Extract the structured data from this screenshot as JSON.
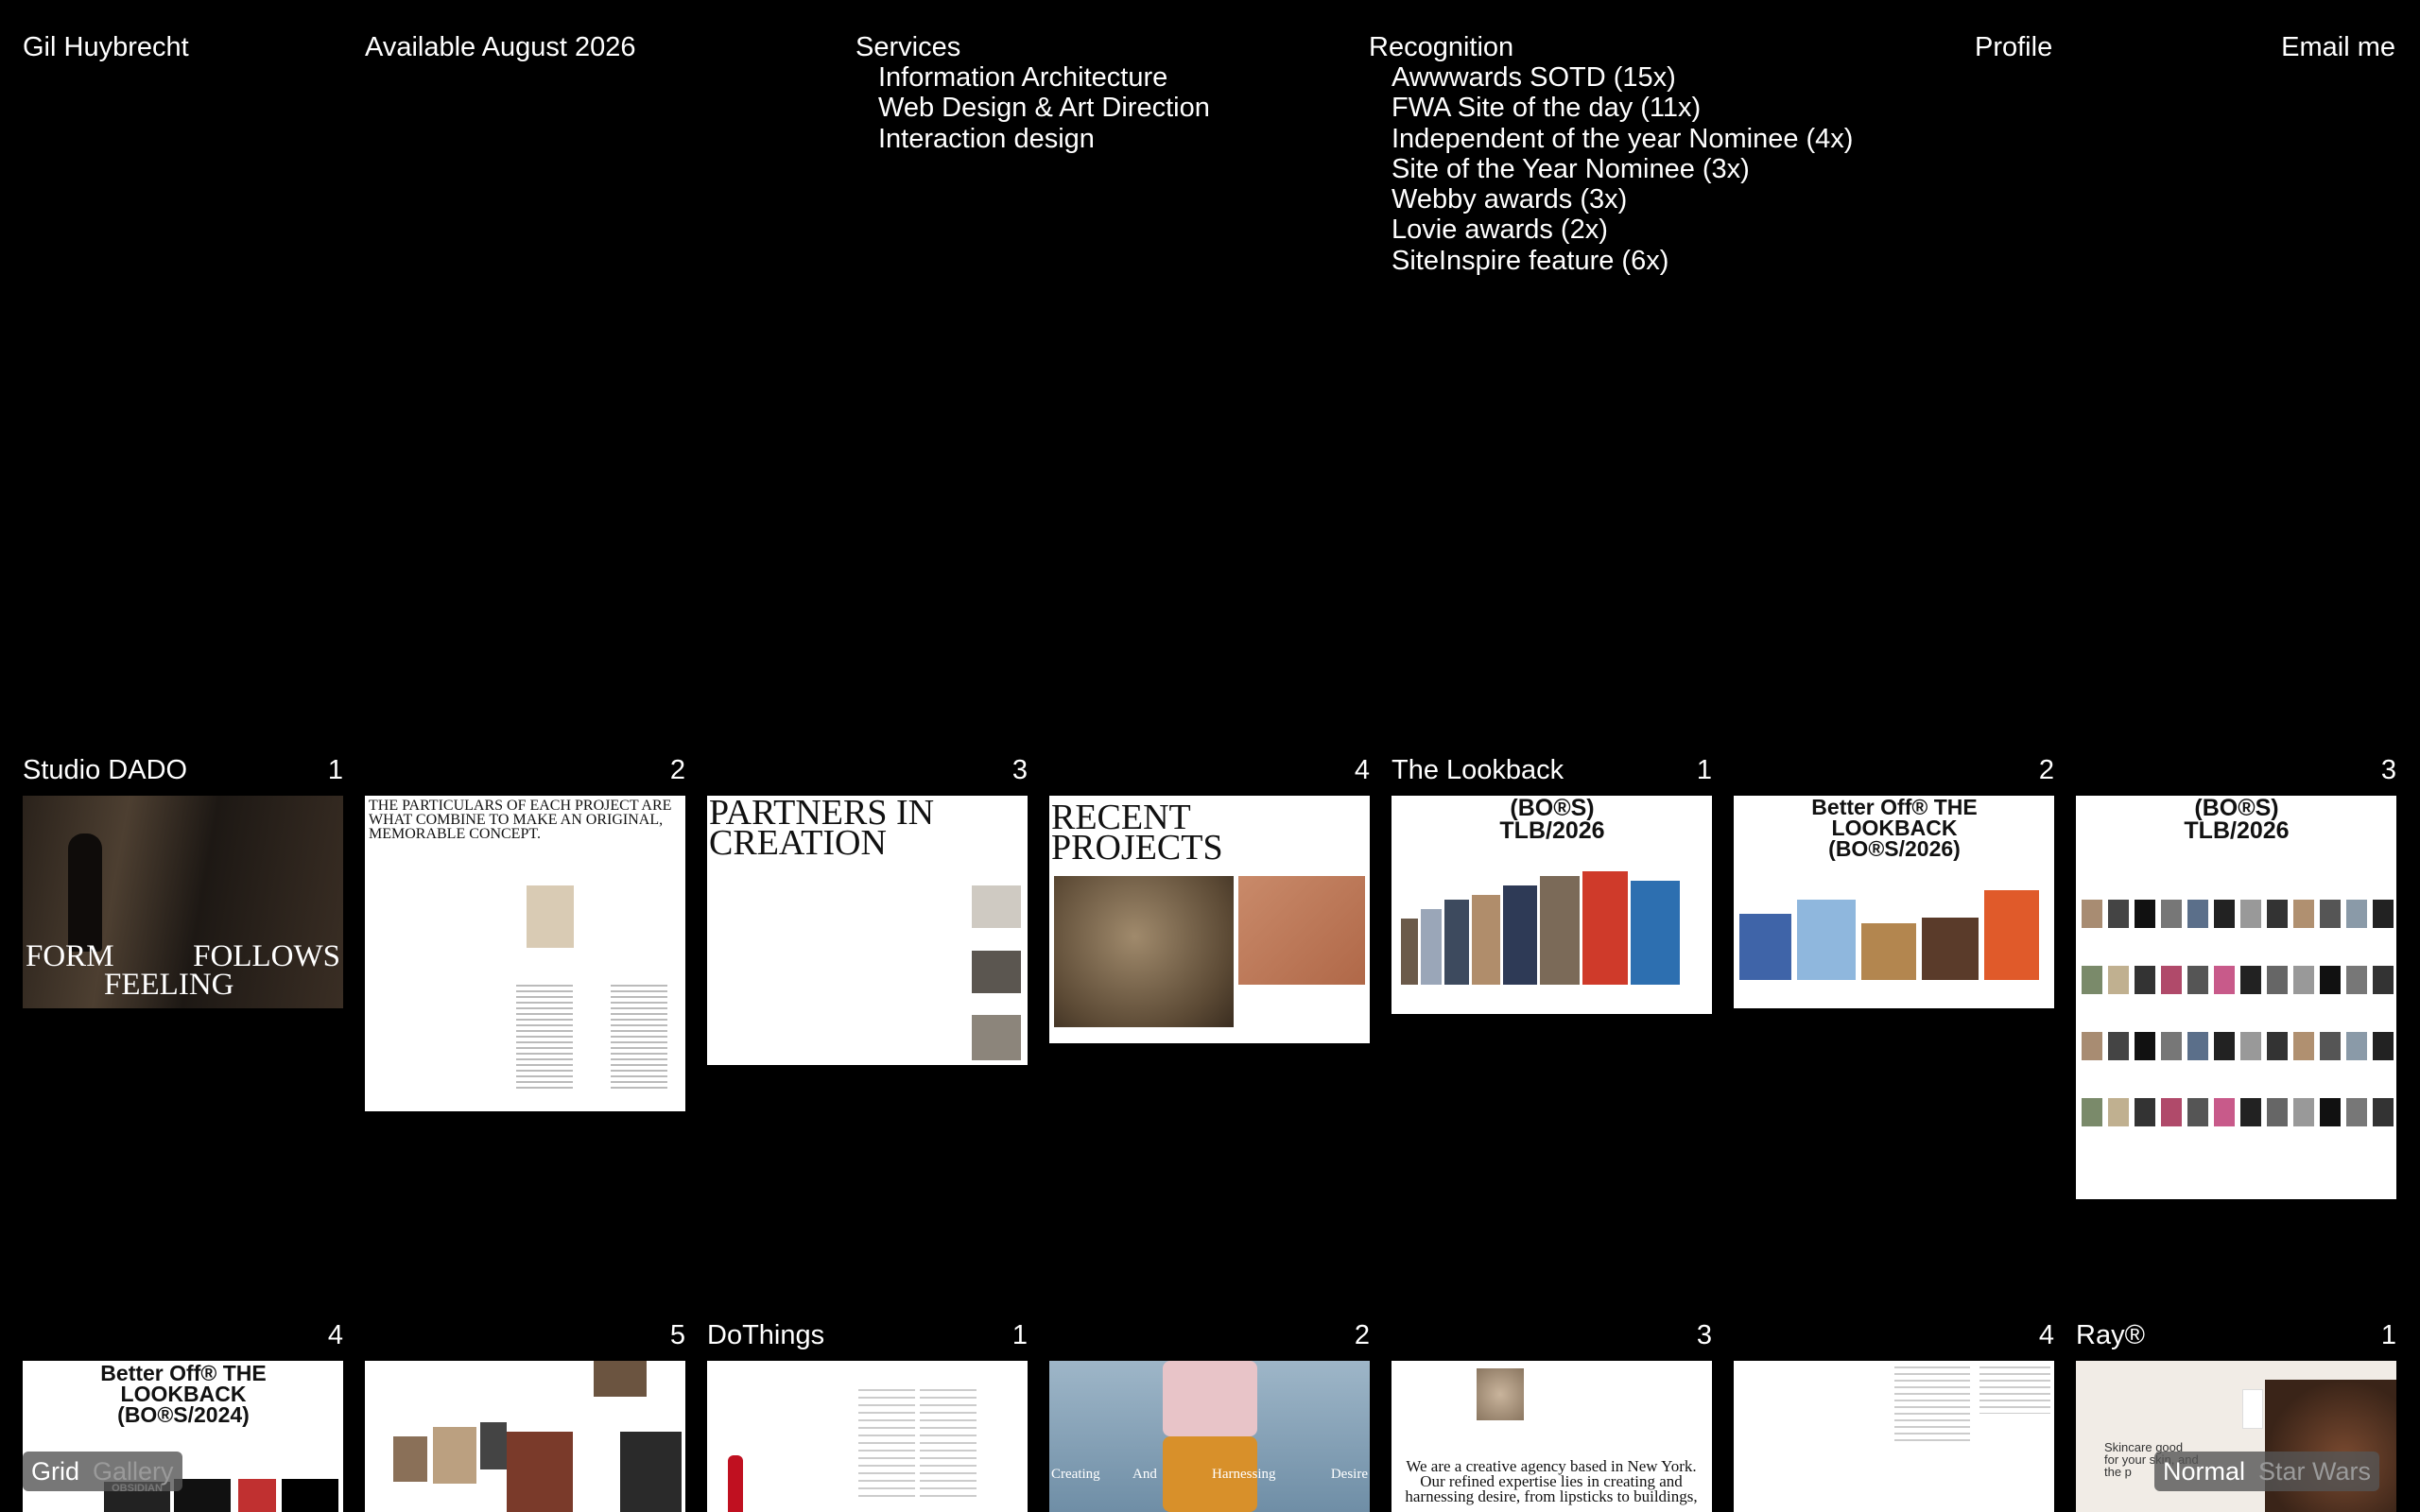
{
  "header": {
    "name": "Gil Huybrecht",
    "availability": "Available August 2026",
    "services_label": "Services",
    "services": [
      "Information Architecture",
      "Web Design & Art Direction",
      "Interaction design"
    ],
    "recognition_label": "Recognition",
    "recognition": [
      "Awwwards SOTD (15x)",
      "FWA Site of the day (11x)",
      "Independent of the year Nominee (4x)",
      "Site of the Year Nominee (3x)",
      "Webby awards (3x)",
      "Lovie awards (2x)",
      "SiteInspire feature (6x)"
    ],
    "profile": "Profile",
    "email": "Email me"
  },
  "projects": {
    "dado": {
      "name": "Studio DADO",
      "n1": "1",
      "n2": "2",
      "n3": "3",
      "n4": "4",
      "s1_line1": "FORM",
      "s1_line2": "FOLLOWS",
      "s1_line3": "FEELING",
      "s2_head": "THE PARTICULARS OF EACH PROJECT ARE WHAT COMBINE TO MAKE AN ORIGINAL, MEMORABLE CONCEPT.",
      "s3_head": "PARTNERS IN CREATION",
      "s4_head": "RECENT PROJECTS"
    },
    "lookback": {
      "name": "The Lookback",
      "n1": "1",
      "n2": "2",
      "n3": "3",
      "n4": "4",
      "n5": "5",
      "s1_head": "(BO®S) TLB/2026",
      "s2_head": "Better Off® THE LOOKBACK (BO®S/2026)",
      "s3_head": "(BO®S) TLB/2026",
      "s4_head": "Better Off® THE LOOKBACK (BO®S/2024)",
      "s4_sub": "OBSIDIAN"
    },
    "dothings": {
      "name": "DoThings",
      "n1": "1",
      "n2": "2",
      "n3": "3",
      "n4": "4",
      "s2_words": [
        "Creating",
        "And",
        "Harnessing",
        "Desire"
      ],
      "s3_text": "We are a creative agency based in New York. Our refined expertise lies in creating and harnessing desire, from lipsticks to buildings,"
    },
    "ray": {
      "name": "Ray®",
      "n1": "1",
      "s1_text": "Skincare good for your skin, and the p"
    }
  },
  "view_toggle": {
    "grid": "Grid",
    "gallery": "Gallery"
  },
  "mode_toggle": {
    "normal": "Normal",
    "starwars": "Star Wars"
  }
}
